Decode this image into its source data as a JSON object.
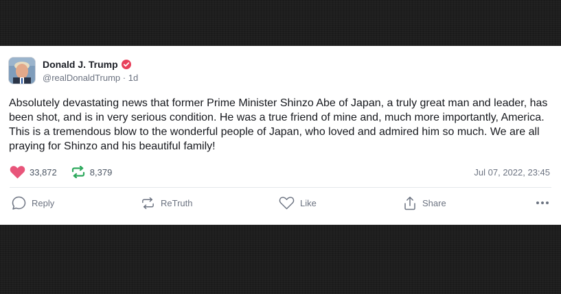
{
  "post": {
    "author": {
      "display_name": "Donald J. Trump",
      "handle": "@realDonaldTrump",
      "age": "1d",
      "verified": true
    },
    "text": "Absolutely devastating news that former Prime Minister Shinzo Abe of Japan, a truly great man and leader, has been shot, and is in very serious condition. He was a true friend of mine and, much more importantly, America. This is a tremendous blow to the wonderful people of Japan, who loved and admired him so much. We are all praying for Shinzo and his beautiful family!",
    "stats": {
      "likes": "33,872",
      "retruths": "8,379"
    },
    "timestamp": "Jul 07, 2022, 23:45"
  },
  "actions": {
    "reply": "Reply",
    "retruth": "ReTruth",
    "like": "Like",
    "share": "Share"
  },
  "icons": {
    "verified": "verified-badge-icon",
    "likes": "heart-icon",
    "retruths": "retruth-icon",
    "reply": "speech-bubble-icon",
    "retruth": "retruth-icon",
    "like": "heart-outline-icon",
    "share": "share-icon",
    "more": "ellipsis-icon"
  },
  "colors": {
    "brand_red": "#e8405b",
    "like_pink": "#e8557a",
    "retruth_green": "#2ea95d",
    "text": "#16181d",
    "muted": "#6b7280"
  }
}
